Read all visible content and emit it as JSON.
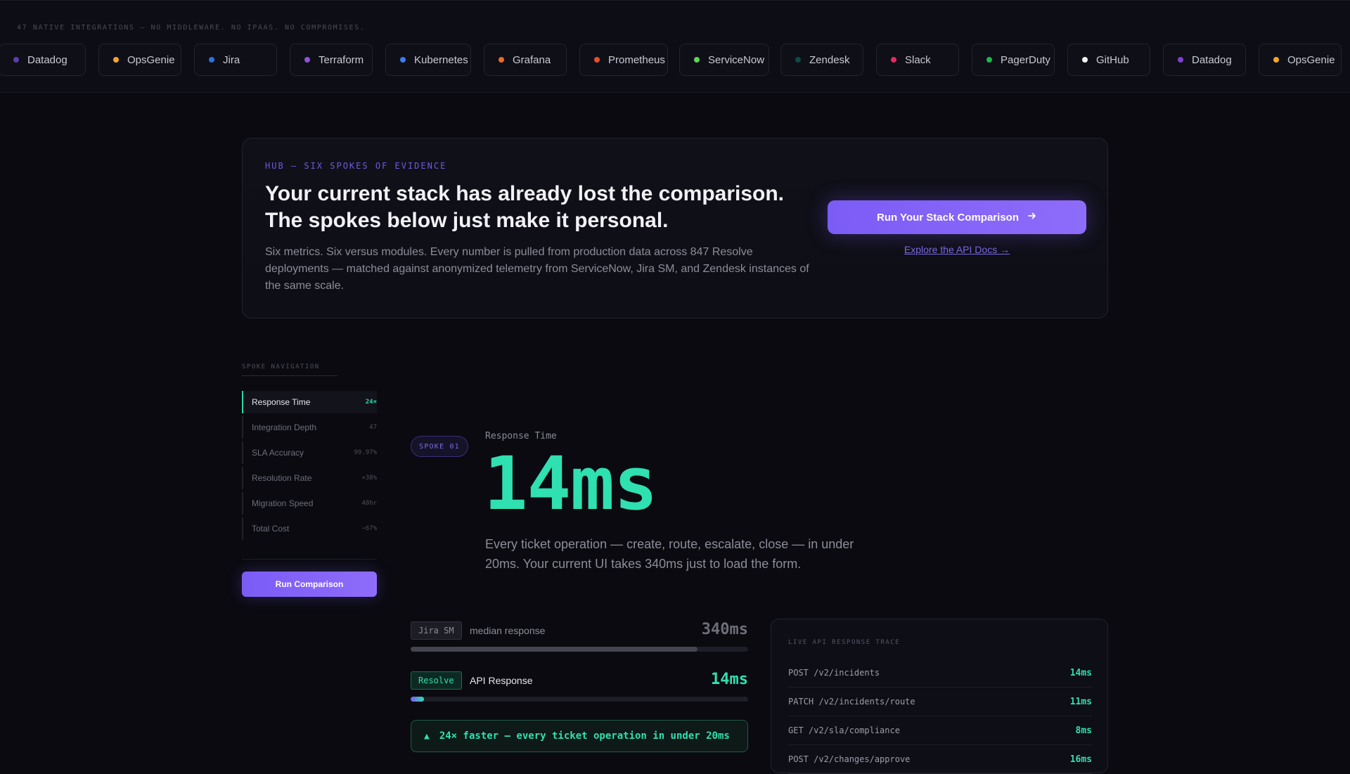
{
  "integrations": {
    "label": "47 NATIVE INTEGRATIONS — NO MIDDLEWARE. NO IPAAS. NO COMPROMISES.",
    "chips": [
      {
        "name": "Datadog",
        "color": "#5b3fa8"
      },
      {
        "name": "OpsGenie",
        "color": "#f5a623"
      },
      {
        "name": "Jira",
        "color": "#2f6fe0"
      },
      {
        "name": "Terraform",
        "color": "#8e55d6"
      },
      {
        "name": "Kubernetes",
        "color": "#3a7bf0"
      },
      {
        "name": "Grafana",
        "color": "#f06a24"
      },
      {
        "name": "Prometheus",
        "color": "#e8502a"
      },
      {
        "name": "ServiceNow",
        "color": "#5fd35a"
      },
      {
        "name": "Zendesk",
        "color": "#0f4a44"
      },
      {
        "name": "Slack",
        "color": "#e8295c"
      },
      {
        "name": "PagerDuty",
        "color": "#1fb84a"
      },
      {
        "name": "GitHub",
        "color": "#f2f2f2"
      },
      {
        "name": "Datadog",
        "color": "#7f3fd0"
      },
      {
        "name": "OpsGenie",
        "color": "#f5a623"
      }
    ]
  },
  "hub": {
    "kicker": "HUB — SIX SPOKES OF EVIDENCE",
    "title_line1": "Your current stack has already lost the comparison.",
    "title_line2": "The spokes below just make it personal.",
    "description": "Six metrics. Six versus modules. Every number is pulled from production data across 847 Resolve deployments — matched against anonymized telemetry from ServiceNow, Jira SM, and Zendesk instances of the same scale.",
    "cta_label": "Run Your Stack Comparison",
    "cta_icon": "arrow-right-icon",
    "link_label": "Explore the API Docs →"
  },
  "sidebar": {
    "label": "SPOKE NAVIGATION",
    "items": [
      {
        "label": "Response Time",
        "value": "24×",
        "active": true
      },
      {
        "label": "Integration Depth",
        "value": "47",
        "active": false
      },
      {
        "label": "SLA Accuracy",
        "value": "99.97%",
        "active": false
      },
      {
        "label": "Resolution Rate",
        "value": "+38%",
        "active": false
      },
      {
        "label": "Migration Speed",
        "value": "48hr",
        "active": false
      },
      {
        "label": "Total Cost",
        "value": "−67%",
        "active": false
      }
    ],
    "button_label": "Run Comparison"
  },
  "spoke": {
    "badge": "SPOKE 01",
    "label": "Response Time",
    "big_value": "14ms",
    "description": "Every ticket operation — create, route, escalate, close — in under 20ms. Your current UI takes 340ms just to load the form."
  },
  "comparison": {
    "rows": [
      {
        "tag": "Jira SM",
        "name": "median response",
        "value": "340ms",
        "fill_fraction": 0.85,
        "fill": "#44444e",
        "value_color": "#6e6e7a",
        "name_color": "#8c8c98"
      },
      {
        "tag": "Resolve",
        "name": "API Response",
        "value": "14ms",
        "fill_fraction": 0.04,
        "fill": "linear-gradient(90deg,#7b5cf5,#2fe0b0)",
        "value_color": "#2fe0b0",
        "name_color": "#e6e6ee"
      }
    ],
    "callout": "24× faster — every ticket operation in under 20ms",
    "callout_icon": "triangle-up-icon"
  },
  "trace": {
    "label": "LIVE API RESPONSE TRACE",
    "rows": [
      {
        "endpoint": "POST /v2/incidents",
        "ms": "14ms"
      },
      {
        "endpoint": "PATCH /v2/incidents/route",
        "ms": "11ms"
      },
      {
        "endpoint": "GET /v2/sla/compliance",
        "ms": "8ms"
      },
      {
        "endpoint": "POST /v2/changes/approve",
        "ms": "16ms"
      }
    ]
  },
  "colors": {
    "accent": "#7b5cf5",
    "success": "#2fe0b0",
    "background": "#0a0a10"
  }
}
